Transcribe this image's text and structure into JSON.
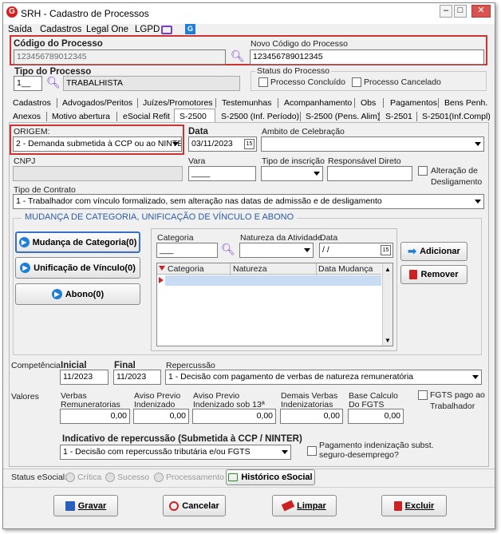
{
  "window": {
    "title": "SRH - Cadastro de Processos",
    "app_icon_letter": "G"
  },
  "menu": {
    "items": [
      "Saída",
      "Cadastros",
      "Legal One",
      "LGPD"
    ]
  },
  "codigo": {
    "label": "Código do Processo",
    "value": "123456789012345",
    "novo_label": "Novo Código do Processo",
    "novo_value": "123456789012345"
  },
  "tipo": {
    "label": "Tipo do Processo",
    "code": "1__",
    "desc": "TRABALHISTA"
  },
  "status": {
    "label": "Status do Processo",
    "concluido": "Processo Concluído",
    "cancelado": "Processo Cancelado"
  },
  "tabs_row1": [
    "Cadastros",
    "Advogados/Peritos",
    "Juízes/Promotores",
    "Testemunhas",
    "Acompanhamento",
    "Obs",
    "Pagamentos",
    "Bens Penh."
  ],
  "tabs_row2": [
    "Anexos",
    "Motivo abertura",
    "eSocial Refit",
    "S-2500",
    "S-2500 (Inf. Período)",
    "S-2500 (Pens. Alim)",
    "S-2501",
    "S-2501(Inf.Compl)"
  ],
  "form": {
    "origem_label": "ORIGEM:",
    "origem_value": "2 - Demanda submetida à CCP ou ao NINTER",
    "data_label": "Data",
    "data_value": "03/11/2023",
    "ambito_label": "Ambito de Celebração",
    "ambito_value": "",
    "cnpj_label": "CNPJ",
    "vara_label": "Vara",
    "vara_value": "____",
    "tipo_inscricao_label": "Tipo de inscrição",
    "responsavel_label": "Responsável Direto",
    "alteracao_label": "Alteração de Desligamento",
    "tipo_contrato_label": "Tipo de Contrato",
    "tipo_contrato_value": "1 - Trabalhador com vínculo formalizado, sem alteração nas datas de admissão e de desligamento"
  },
  "mudanca": {
    "title": "MUDANÇA DE CATEGORIA, UNIFICAÇÃO DE VÍNCULO E ABONO",
    "btn_mudanca": "Mudança de Categoria(0)",
    "btn_unificacao": "Unificação de Vínculo(0)",
    "btn_abono": "Abono(0)",
    "categoria_label": "Categoria",
    "categoria_value": "___",
    "natureza_label": "Natureza da Atividade",
    "data_label": "Data",
    "data_value": "/ /",
    "grid_columns": [
      "Categoria",
      "Natureza",
      "Data Mudança"
    ],
    "adicionar": "Adicionar",
    "remover": "Remover"
  },
  "competencia": {
    "label": "Competência",
    "inicial_label": "Inicial",
    "inicial_value": "11/2023",
    "final_label": "Final",
    "final_value": "11/2023",
    "repercussao_label": "Repercussão",
    "repercussao_value": "1 - Decisão com pagamento de verbas de natureza remuneratória"
  },
  "valores": {
    "label": "Valores",
    "verbas_label1": "Verbas",
    "verbas_label2": "Remuneratorias",
    "verbas_value": "0,00",
    "aviso_label1": "Aviso Previo",
    "aviso_label2": "Indenizado",
    "aviso_value": "0,00",
    "aviso13_label1": "Aviso Previo",
    "aviso13_label2": "Indenizado sob 13ª",
    "aviso13_value": "0,00",
    "demais_label1": "Demais Verbas",
    "demais_label2": "Indenizatorias",
    "demais_value": "0,00",
    "base_label1": "Base Calculo",
    "base_label2": "Do FGTS",
    "base_value": "0,00",
    "fgts_label1": "FGTS pago ao",
    "fgts_label2": "Trabalhador"
  },
  "indicativo": {
    "label": "Indicativo de repercussão (Submetida à CCP / NINTER)",
    "value": "1 - Decisão com repercussão tributária e/ou FGTS",
    "pagamento_label1": "Pagamento indenização subst.",
    "pagamento_label2": "seguro-desemprego?"
  },
  "statusbar": {
    "label": "Status eSocial:",
    "critica": "Crítica",
    "sucesso": "Sucesso",
    "processamento": "Processamento",
    "historico": "Histórico eSocial"
  },
  "actions": {
    "gravar": "Gravar",
    "cancelar": "Cancelar",
    "limpar": "Limpar",
    "excluir": "Excluir"
  },
  "colors": {
    "highlight_red": "#cc3333",
    "accent_blue": "#1e7fd8",
    "grid_selected": "#c8dcf4"
  }
}
